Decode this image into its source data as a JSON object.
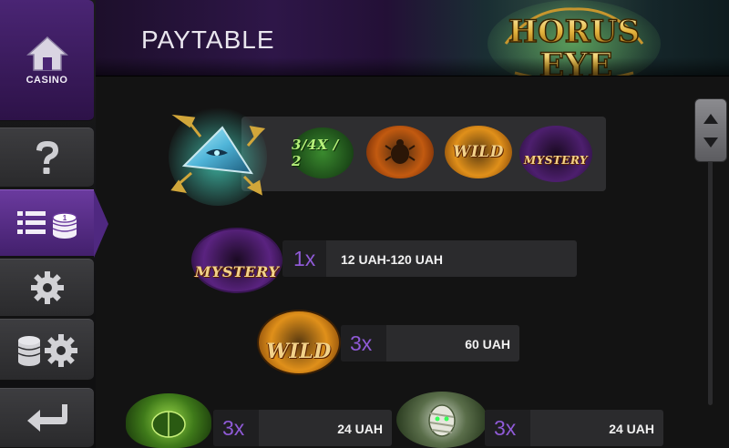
{
  "header": {
    "title": "PAYTABLE",
    "logo_text_top": "HORUS",
    "logo_text_bottom": "EYE"
  },
  "sidebar": {
    "casino_label": "CASINO",
    "items": [
      {
        "icon": "house-icon"
      },
      {
        "icon": "question-mark-icon"
      },
      {
        "icon": "paytable-list-icon",
        "active": true
      },
      {
        "icon": "gear-icon"
      },
      {
        "icon": "coins-gear-icon"
      },
      {
        "icon": "back-arrow-icon"
      }
    ]
  },
  "combo": {
    "scatter_symbol": "eye-pyramid-icon",
    "symbols": [
      {
        "name": "Multiplier",
        "label": "3/4X / 2"
      },
      {
        "name": "Scarab feature",
        "label": ""
      },
      {
        "name": "Wild",
        "label": "WILD"
      },
      {
        "name": "Mystery",
        "label": "MYSTERY"
      }
    ]
  },
  "paytable": [
    {
      "symbol": "Mystery",
      "label": "MYSTERY",
      "multiplier": "1x",
      "amount": "12 UAH-120 UAH"
    },
    {
      "symbol": "Wild",
      "label": "WILD",
      "multiplier": "3x",
      "amount": "60 UAH"
    },
    {
      "symbol": "Green scarab",
      "label": "",
      "multiplier": "3x",
      "amount": "24 UAH"
    },
    {
      "symbol": "Mummy",
      "label": "",
      "multiplier": "3x",
      "amount": "24 UAH"
    }
  ],
  "colors": {
    "accent": "#6a3a9e",
    "multiplier": "#8f5ad6",
    "bar": "#2b2b2d"
  }
}
